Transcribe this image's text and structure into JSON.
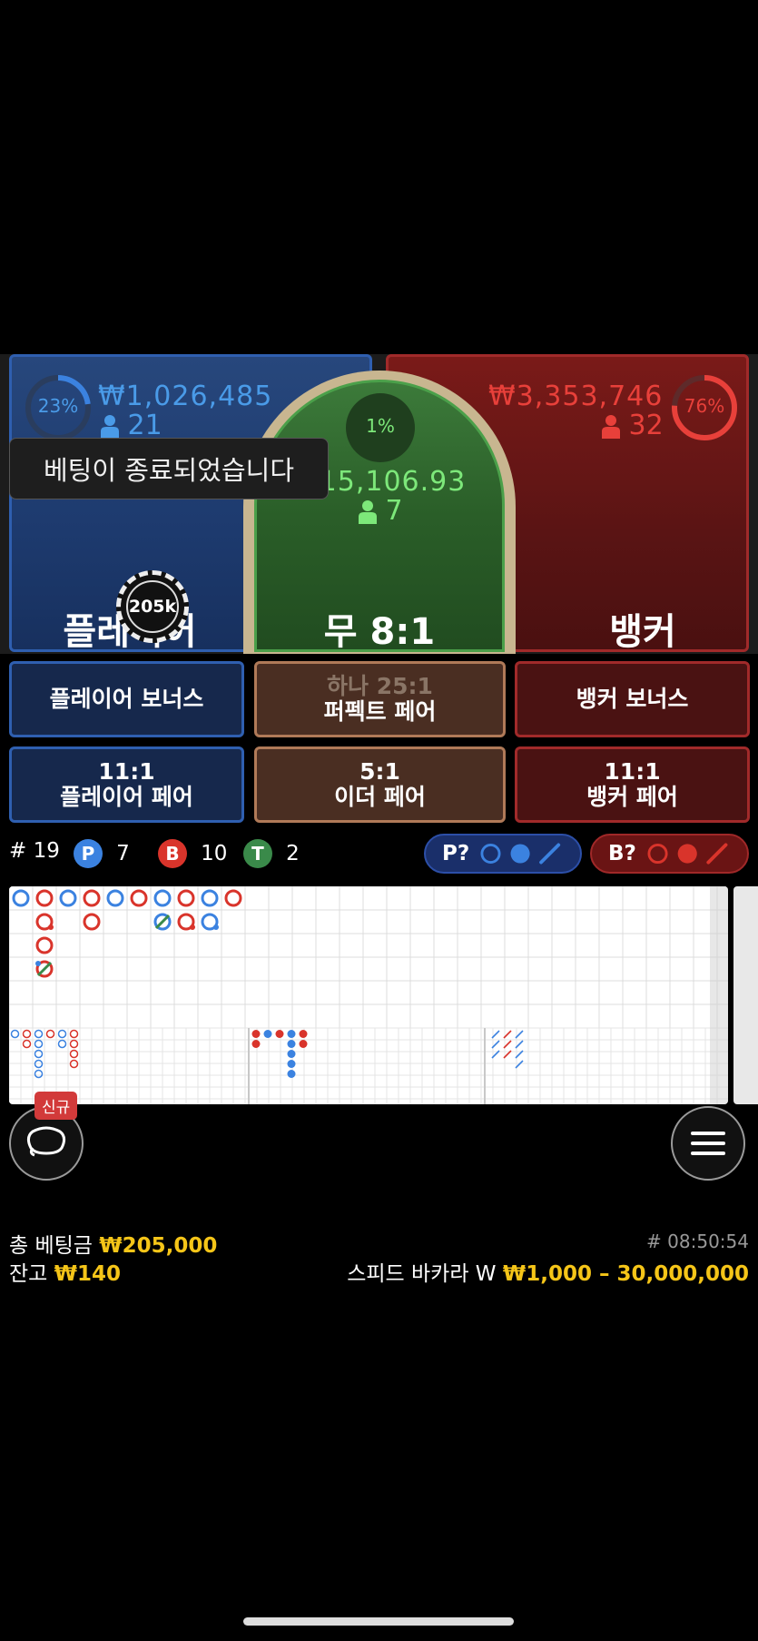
{
  "table": {
    "player": {
      "percent": "23%",
      "percent_value": 0.23,
      "amount": "₩1,026,485",
      "players": "21",
      "label": "플레이어"
    },
    "tie": {
      "percent": "1%",
      "percent_value": 0.01,
      "amount": "₩15,106.93",
      "players": "7",
      "label": "무 8:1"
    },
    "banker": {
      "percent": "76%",
      "percent_value": 0.76,
      "amount": "₩3,353,746",
      "players": "32",
      "label": "뱅커"
    },
    "toast": "베팅이 종료되었습니다",
    "chip": "205k"
  },
  "side_bets": {
    "player_bonus": "플레이어 보너스",
    "perfect_pair_top": "하나 25:1",
    "perfect_pair": "퍼펙트 페어",
    "banker_bonus": "뱅커 보너스",
    "player_pair_odds": "11:1",
    "player_pair": "플레이어 페어",
    "either_pair_odds": "5:1",
    "either_pair": "이더 페어",
    "banker_pair_odds": "11:1",
    "banker_pair": "뱅커 페어"
  },
  "stats": {
    "round": "# 19",
    "player_badge": "P",
    "player_count": "7",
    "banker_badge": "B",
    "banker_count": "10",
    "tie_badge": "T",
    "tie_count": "2",
    "player_predict": "P?",
    "banker_predict": "B?"
  },
  "colors": {
    "player": "#3b82e0",
    "banker": "#d9342b",
    "tie": "#3a8a4a",
    "gold": "#f5c518"
  },
  "bottom": {
    "new_badge": "신규",
    "chat_icon": "chat-bubble-icon",
    "menu_icon": "hamburger-menu-icon",
    "total_bet_label": "총 베팅금",
    "total_bet_value": "₩205,000",
    "balance_label": "잔고",
    "balance_value": "₩140",
    "game_id": "# 08:50:54",
    "game_name": "스피드 바카라 W",
    "limits": "₩1,000 – 30,000,000"
  }
}
